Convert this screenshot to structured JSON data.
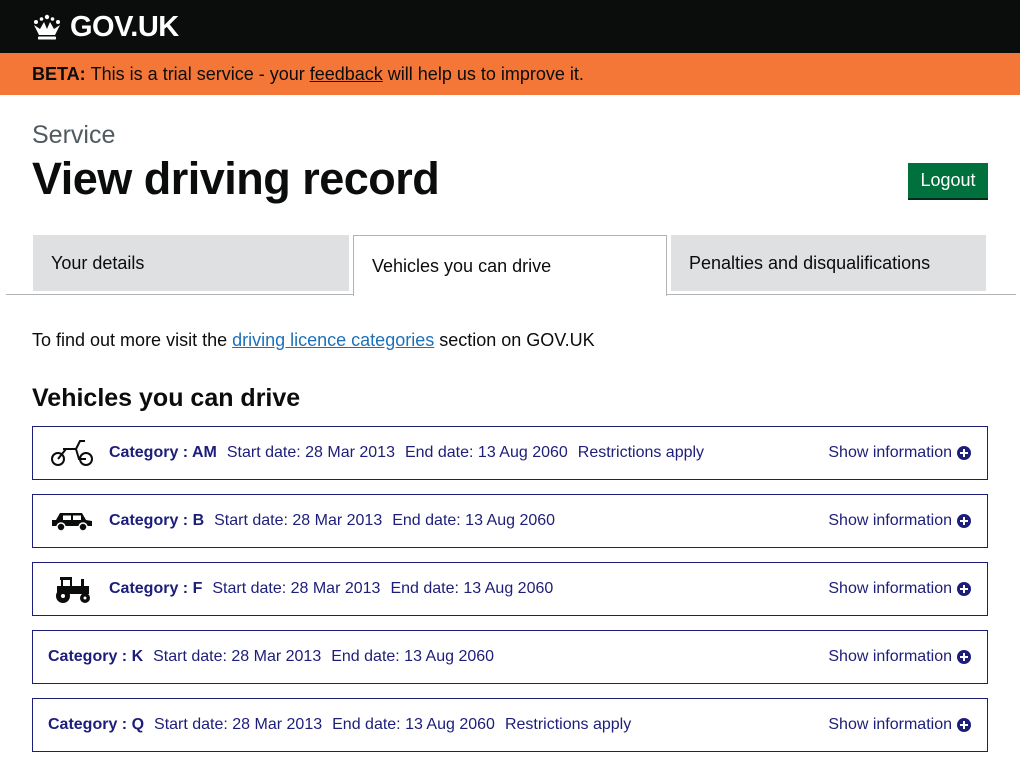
{
  "header": {
    "logo_text": "GOV.UK",
    "logo_icon": "crown-icon"
  },
  "beta": {
    "tag": "BETA:",
    "text_before": "This is a trial service - your",
    "link": "feedback",
    "text_after": "will help us to improve it."
  },
  "page": {
    "caption": "Service",
    "title": "View driving record",
    "logout_label": "Logout"
  },
  "tabs": [
    {
      "label": "Your details",
      "active": false
    },
    {
      "label": "Vehicles you can drive",
      "active": true
    },
    {
      "label": "Penalties and disqualifications",
      "active": false
    }
  ],
  "intro": {
    "before": "To find out more visit the",
    "link": "driving licence categories",
    "after": "section on GOV.UK"
  },
  "section_heading": "Vehicles you can drive",
  "categories": [
    {
      "label": "Category : AM",
      "start": "Start date: 28 Mar 2013",
      "end": "End date: 13 Aug 2060",
      "restrictions": "Restrictions apply",
      "icon": "moped-icon",
      "action": "Show information"
    },
    {
      "label": "Category : B",
      "start": "Start date: 28 Mar 2013",
      "end": "End date: 13 Aug 2060",
      "restrictions": "",
      "icon": "car-icon",
      "action": "Show information"
    },
    {
      "label": "Category : F",
      "start": "Start date: 28 Mar 2013",
      "end": "End date: 13 Aug 2060",
      "restrictions": "",
      "icon": "tractor-icon",
      "action": "Show information"
    },
    {
      "label": "Category : K",
      "start": "Start date: 28 Mar 2013",
      "end": "End date: 13 Aug 2060",
      "restrictions": "",
      "icon": "",
      "action": "Show information"
    },
    {
      "label": "Category : Q",
      "start": "Start date: 28 Mar 2013",
      "end": "End date: 13 Aug 2060",
      "restrictions": "Restrictions apply",
      "icon": "",
      "action": "Show information"
    }
  ],
  "colors": {
    "header_bg": "#0b0c0c",
    "beta_bg": "#f47738",
    "button_green": "#00703c",
    "link_blue": "#1d70b8",
    "category_text": "#1d1d7a"
  }
}
